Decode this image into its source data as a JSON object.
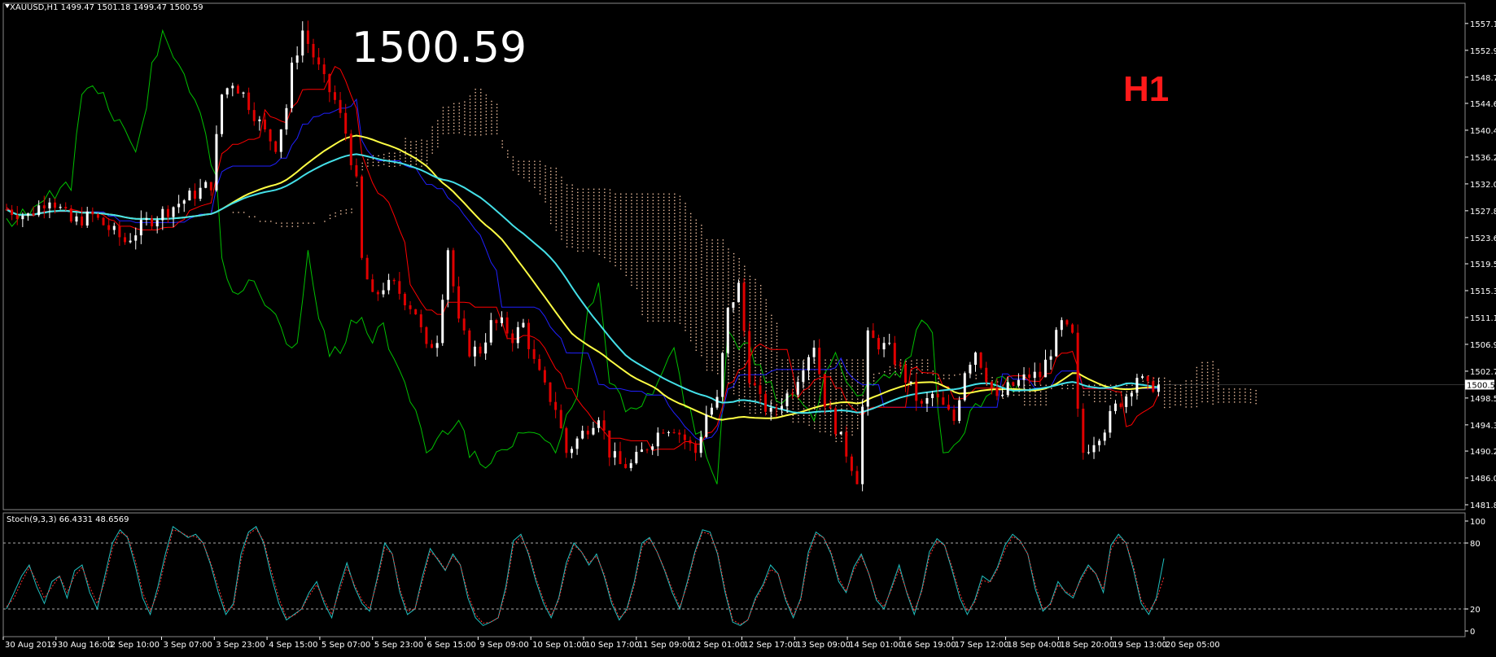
{
  "header": {
    "symbol_line": "XAUUSD,H1  1499.47 1501.18 1499.47 1500.59",
    "big_price": "1500.59",
    "timeframe": "H1"
  },
  "stoch_header": "Stoch(9,3,3) 66.4331 48.6569",
  "colors": {
    "background": "#000000",
    "bull_candle": "#ffffff",
    "bear_candle": "#e00000",
    "kijun": "#2020ff",
    "tenkan": "#ff0000",
    "chikou": "#00c000",
    "ma_fast": "#ffff44",
    "ma_slow": "#44e0e8",
    "cloud": "#f0c0a0",
    "stoch_main": "#20c0c0",
    "stoch_signal": "#ff3030"
  },
  "chart_data": [
    {
      "type": "candlestick",
      "title": "XAUUSD,H1",
      "ylim": [
        1481.8,
        1559.5
      ],
      "y_ticks": [
        "1557.10",
        "1552.90",
        "1548.70",
        "1544.60",
        "1540.40",
        "1536.20",
        "1532.00",
        "1527.80",
        "1523.60",
        "1519.50",
        "1515.30",
        "1511.10",
        "1506.90",
        "1502.70",
        "1498.50",
        "1494.30",
        "1490.20",
        "1486.00",
        "1481.80"
      ],
      "current_price_label": "1500.59",
      "x_ticks": [
        "30 Aug 2019",
        "30 Aug 16:00",
        "2 Sep 10:00",
        "3 Sep 07:00",
        "3 Sep 23:00",
        "4 Sep 15:00",
        "5 Sep 07:00",
        "5 Sep 23:00",
        "6 Sep 15:00",
        "9 Sep 09:00",
        "10 Sep 01:00",
        "10 Sep 17:00",
        "11 Sep 09:00",
        "12 Sep 01:00",
        "12 Sep 17:00",
        "13 Sep 09:00",
        "14 Sep 01:00",
        "16 Sep 19:00",
        "17 Sep 12:00",
        "18 Sep 04:00",
        "18 Sep 20:00",
        "19 Sep 13:00",
        "20 Sep 05:00"
      ],
      "price_path": [
        [
          0,
          1528
        ],
        [
          4,
          1527
        ],
        [
          8,
          1530
        ],
        [
          12,
          1526
        ],
        [
          16,
          1527
        ],
        [
          22,
          1523
        ],
        [
          26,
          1526
        ],
        [
          30,
          1528
        ],
        [
          34,
          1530
        ],
        [
          38,
          1532
        ],
        [
          40,
          1546
        ],
        [
          42,
          1548
        ],
        [
          44,
          1546
        ],
        [
          46,
          1543
        ],
        [
          48,
          1540
        ],
        [
          50,
          1538
        ],
        [
          52,
          1544
        ],
        [
          53,
          1550
        ],
        [
          55,
          1556
        ],
        [
          57,
          1552
        ],
        [
          59,
          1548
        ],
        [
          61,
          1545
        ],
        [
          63,
          1540
        ],
        [
          65,
          1532
        ],
        [
          66,
          1520
        ],
        [
          68,
          1514
        ],
        [
          70,
          1516
        ],
        [
          72,
          1516
        ],
        [
          74,
          1514
        ],
        [
          76,
          1512
        ],
        [
          78,
          1506
        ],
        [
          80,
          1508
        ],
        [
          82,
          1522
        ],
        [
          84,
          1510
        ],
        [
          86,
          1506
        ],
        [
          88,
          1506
        ],
        [
          90,
          1510
        ],
        [
          92,
          1510
        ],
        [
          94,
          1508
        ],
        [
          96,
          1510
        ],
        [
          98,
          1504
        ],
        [
          100,
          1500
        ],
        [
          102,
          1497
        ],
        [
          104,
          1490
        ],
        [
          106,
          1492
        ],
        [
          108,
          1494
        ],
        [
          110,
          1496
        ],
        [
          112,
          1490
        ],
        [
          114,
          1488
        ],
        [
          116,
          1488
        ],
        [
          118,
          1490
        ],
        [
          120,
          1492
        ],
        [
          122,
          1494
        ],
        [
          124,
          1494
        ],
        [
          126,
          1492
        ],
        [
          128,
          1490
        ],
        [
          130,
          1496
        ],
        [
          132,
          1498
        ],
        [
          134,
          1512
        ],
        [
          136,
          1516
        ],
        [
          138,
          1502
        ],
        [
          140,
          1498
        ],
        [
          142,
          1496
        ],
        [
          144,
          1498
        ],
        [
          146,
          1500
        ],
        [
          148,
          1504
        ],
        [
          150,
          1507
        ],
        [
          152,
          1498
        ],
        [
          154,
          1494
        ],
        [
          156,
          1490
        ],
        [
          158,
          1486
        ],
        [
          160,
          1508
        ],
        [
          162,
          1507
        ],
        [
          164,
          1506
        ],
        [
          166,
          1503
        ],
        [
          168,
          1500
        ],
        [
          170,
          1497
        ],
        [
          172,
          1499
        ],
        [
          174,
          1497
        ],
        [
          176,
          1495
        ],
        [
          178,
          1503
        ],
        [
          180,
          1506
        ],
        [
          182,
          1502
        ],
        [
          184,
          1498
        ],
        [
          186,
          1500
        ],
        [
          188,
          1501
        ],
        [
          190,
          1502
        ],
        [
          192,
          1502
        ],
        [
          194,
          1506
        ],
        [
          196,
          1510
        ],
        [
          198,
          1508
        ],
        [
          199,
          1496
        ],
        [
          200,
          1490
        ],
        [
          202,
          1492
        ],
        [
          204,
          1494
        ],
        [
          206,
          1497
        ],
        [
          208,
          1499
        ],
        [
          210,
          1502
        ],
        [
          212,
          1500
        ],
        [
          214,
          1501
        ],
        [
          215,
          1500.59
        ]
      ],
      "chart_type_note": "price candles with Ichimoku cloud and two moving averages"
    },
    {
      "type": "line",
      "title": "Stoch(9,3,3) 66.4331 48.6569",
      "ylim": [
        0,
        100
      ],
      "y_ticks": [
        "100",
        "80",
        "20",
        "0"
      ],
      "levels": [
        80,
        20
      ],
      "series": [
        {
          "values": [
            20,
            35,
            50,
            60,
            40,
            25,
            45,
            50,
            30,
            55,
            60,
            35,
            20,
            50,
            80,
            92,
            85,
            60,
            30,
            15,
            40,
            70,
            95,
            90,
            85,
            88,
            80,
            60,
            35,
            15,
            25,
            70,
            90,
            95,
            80,
            50,
            25,
            10,
            15,
            20,
            35,
            45,
            25,
            12,
            40,
            62,
            40,
            25,
            18,
            48,
            80,
            70,
            35,
            15,
            20,
            50,
            75,
            65,
            55,
            70,
            60,
            30,
            12,
            5,
            8,
            12,
            40,
            82,
            88,
            70,
            45,
            25,
            12,
            30,
            62,
            80,
            72,
            60,
            70,
            50,
            25,
            10,
            20,
            45,
            80,
            85,
            72,
            55,
            35,
            20,
            45,
            72,
            92,
            90,
            70,
            35,
            8,
            5,
            10,
            30,
            42,
            60,
            52,
            28,
            12,
            30,
            72,
            90,
            85,
            70,
            45,
            35,
            58,
            70,
            52,
            28,
            20,
            40,
            60,
            35,
            15,
            38,
            72,
            84,
            78,
            55,
            30,
            15,
            28,
            50,
            45,
            58,
            78,
            88,
            82,
            70,
            38,
            18,
            25,
            45,
            35,
            30,
            48,
            60,
            52,
            35,
            78,
            88,
            80,
            55,
            25,
            15,
            30,
            66
          ]
        },
        {
          "values": [
            22,
            30,
            45,
            58,
            45,
            30,
            40,
            50,
            35,
            50,
            58,
            40,
            25,
            45,
            75,
            90,
            86,
            65,
            35,
            18,
            35,
            65,
            92,
            90,
            86,
            86,
            80,
            62,
            40,
            18,
            22,
            65,
            88,
            93,
            82,
            55,
            30,
            12,
            14,
            20,
            32,
            42,
            28,
            15,
            36,
            58,
            42,
            28,
            20,
            45,
            76,
            70,
            38,
            18,
            20,
            46,
            72,
            66,
            56,
            68,
            60,
            34,
            15,
            7,
            8,
            12,
            36,
            78,
            86,
            72,
            48,
            28,
            14,
            28,
            58,
            78,
            72,
            62,
            68,
            52,
            28,
            12,
            18,
            42,
            76,
            84,
            72,
            56,
            38,
            22,
            42,
            70,
            90,
            88,
            72,
            38,
            10,
            6,
            10,
            28,
            40,
            56,
            52,
            30,
            14,
            28,
            68,
            88,
            85,
            72,
            48,
            36,
            55,
            68,
            52,
            30,
            22,
            38,
            56,
            36,
            18,
            36,
            68,
            82,
            78,
            58,
            34,
            18,
            26,
            46,
            44,
            56,
            74,
            86,
            82,
            70,
            42,
            20,
            24,
            42,
            36,
            32,
            46,
            58,
            52,
            38,
            74,
            86,
            80,
            58,
            28,
            18,
            28,
            49
          ]
        }
      ]
    }
  ]
}
